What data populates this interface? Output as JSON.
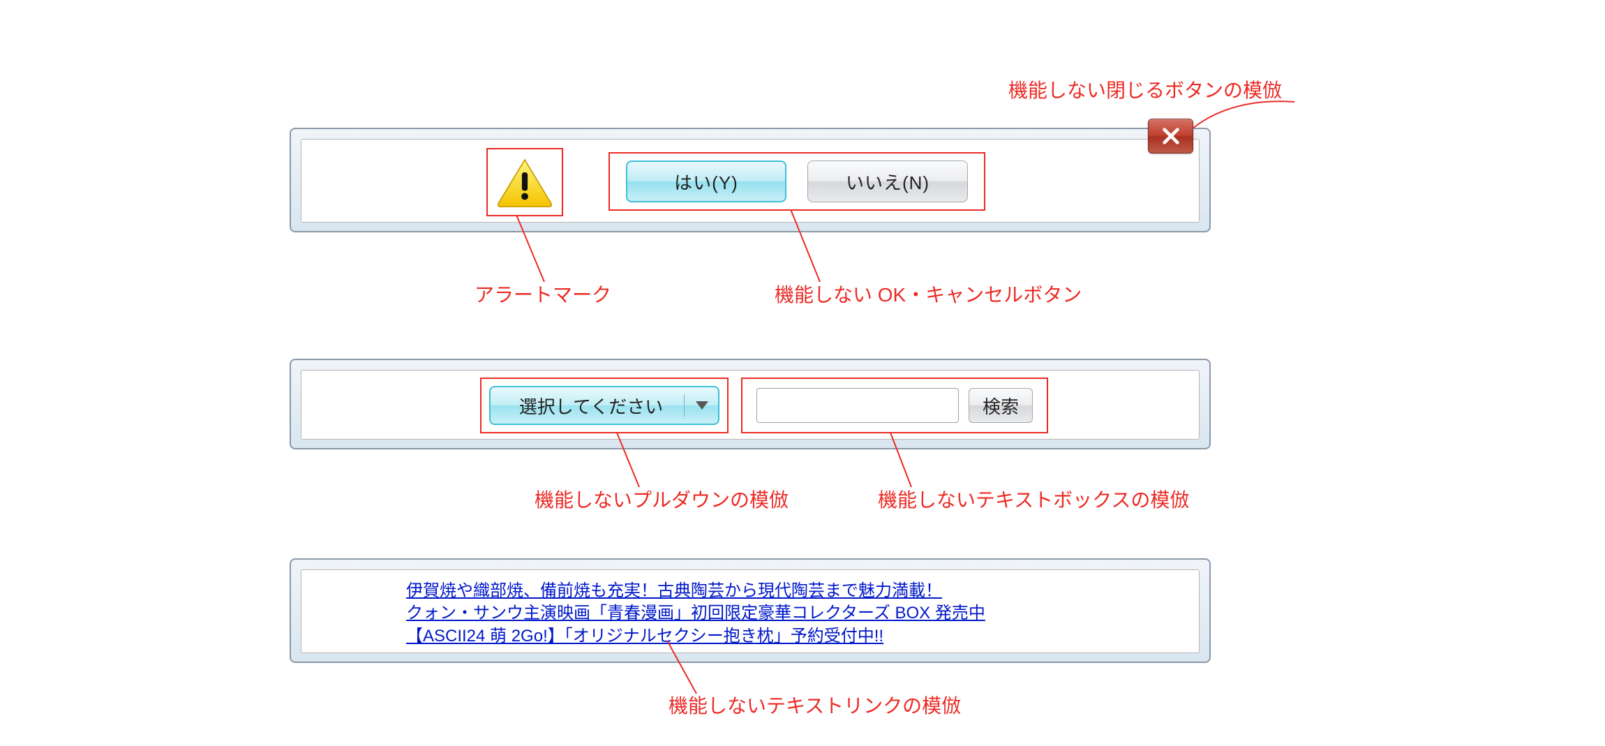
{
  "panel1": {
    "yes_label": "はい(Y)",
    "no_label": "いいえ(N)"
  },
  "panel2": {
    "dropdown_label": "選択してください",
    "search_button_label": "検索"
  },
  "panel3": {
    "links": [
      "伊賀焼や織部焼、備前焼も充実！古典陶芸から現代陶芸まで魅力満載！",
      "クォン・サンウ主演映画「青春漫画」初回限定豪華コレクターズ BOX 発売中",
      "【ASCII24 萌 2Go!】「オリジナルセクシー抱き枕」予約受付中!!"
    ]
  },
  "annotations": {
    "close_button": "機能しない閉じるボタンの模倣",
    "alert_mark": "アラートマーク",
    "ok_cancel": "機能しない OK・キャンセルボタン",
    "pulldown": "機能しないプルダウンの模倣",
    "textbox": "機能しないテキストボックスの模倣",
    "textlink": "機能しないテキストリンクの模倣"
  }
}
